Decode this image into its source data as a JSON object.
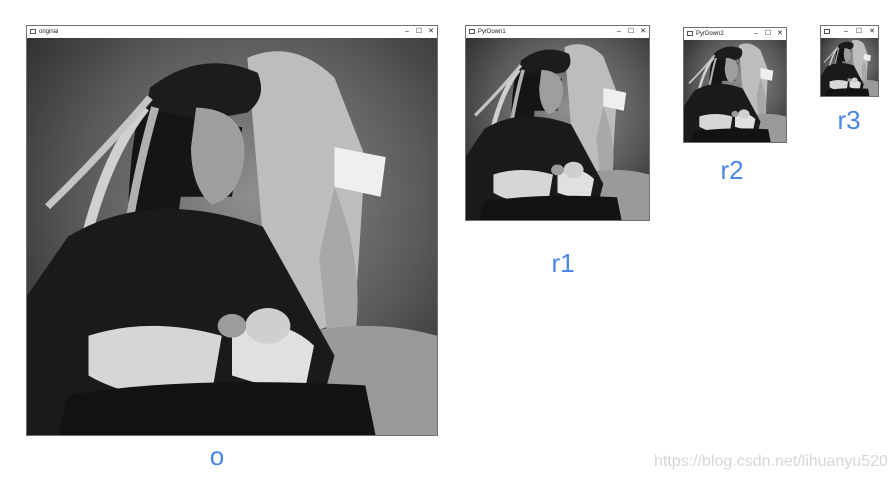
{
  "windows": [
    {
      "title": "original",
      "caption": "o",
      "controls": {
        "minimize": "–",
        "maximize": "☐",
        "close": "✕"
      }
    },
    {
      "title": "PyrDown1",
      "caption": "r1",
      "controls": {
        "minimize": "–",
        "maximize": "☐",
        "close": "✕"
      }
    },
    {
      "title": "PyrDown2",
      "caption": "r2",
      "controls": {
        "minimize": "–",
        "maximize": "☐",
        "close": "✕"
      }
    },
    {
      "title": "",
      "caption": "r3",
      "controls": {
        "minimize": "–",
        "maximize": "☐",
        "close": "✕"
      }
    }
  ],
  "watermark": "https://blog.csdn.net/lihuanyu520",
  "colors": {
    "caption": "#4a86e8",
    "border": "#6f6f6f",
    "watermark": "#d6d6d6"
  },
  "icons": {
    "window": "window-app-icon",
    "minimize": "minimize-icon",
    "maximize": "maximize-icon",
    "close": "close-icon"
  }
}
